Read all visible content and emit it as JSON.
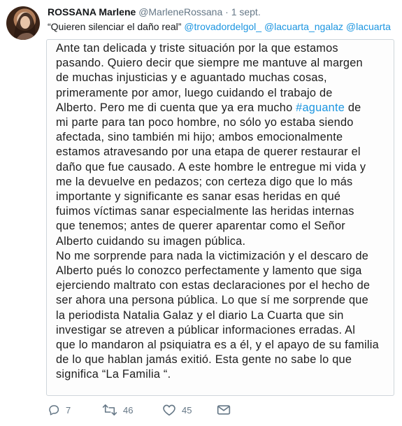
{
  "tweet": {
    "author_name": "ROSSANA Marlene",
    "author_handle": "@MarleneRossana",
    "separator": "·",
    "time": "1 sept.",
    "quote_text": "“Quieren silenciar el daño real”",
    "mentions": [
      "@trovadordelgol_",
      "@lacuarta_ngalaz",
      "@lacuarta"
    ],
    "image_text": {
      "lines": [
        "Ante tan delicada y triste situación por la que estamos",
        "pasando. Quiero decir que siempre me mantuve al margen",
        "de muchas injusticias y e aguantado muchas cosas,",
        "primeramente por amor, luego cuidando el trabajo de",
        "Alberto. Pero me di cuenta que ya era mucho ",
        "mi parte para tan poco hombre, no sólo yo estaba siendo",
        "afectada, sino también mi hijo; ambos emocionalmente",
        "estamos atravesando por una etapa de querer restaurar el",
        "daño que fue causado. A este hombre le entregue mi vida y",
        "me la devuelve en pedazos; con certeza digo que lo más",
        "importante y significante es sanar esas heridas en qué",
        "fuimos víctimas sanar especialmente las heridas internas",
        "que tenemos; antes de querer aparentar como el Señor",
        "Alberto cuidando su imagen pública.",
        "No me sorprende para nada la victimización y el descaro de",
        "Alberto pués lo conozco perfectamente y lamento que siga",
        "ejerciendo maltrato con estas declaraciones por el hecho de",
        "ser ahora una persona pública. Lo que sí me sorprende que",
        "la periodista Natalia Galaz y el diario La Cuarta que sin",
        "investigar se atreven a públicar informaciones erradas. Al",
        "que lo mandaron al psiquiatra es a él, y el apayo de su familia",
        "de lo que hablan jamás exitió. Esta gente no sabe lo que",
        "significa “La Familia “."
      ],
      "hashtag": "#aguante",
      "line5_tail": " de"
    },
    "actions": {
      "reply_icon": "reply-icon",
      "reply_count": "7",
      "retweet_icon": "retweet-icon",
      "retweet_count": "46",
      "like_icon": "heart-icon",
      "like_count": "45",
      "dm_icon": "envelope-icon"
    },
    "colors": {
      "link": "#1b95e0",
      "muted": "#657786",
      "text": "#14171a"
    }
  }
}
